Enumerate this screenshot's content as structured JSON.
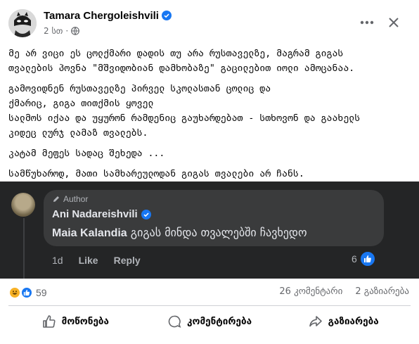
{
  "post": {
    "author": "Tamara Chergoleishvili",
    "time": "2 სთ",
    "menu_icon": "more-dots-icon",
    "close_icon": "close-icon",
    "paragraphs": [
      [
        "მე არ ვიცი ეს ცოლქმარი დადის თუ არა რუსთაველზე, მაგრამ გიგას",
        "თვალების პოვნა \"მშვიდობიან დამხობაზე\" გაცილებით იოლი ამოცანაა."
      ],
      [
        "გამოვიდნენ რუსთაველზე პირველ სკოლასთან ცოლიც და",
        "ქმარიც, გიგა თითქმის ყოველ",
        "სალმოს იქაა და უყურონ რამდენიც გაუხარდებათ - სთხოვონ და გაახელს",
        "კიდეც ლურჯ ლამაზ თვალებს."
      ],
      [
        "კატამ მეფეს სადაც შეხედა ..."
      ],
      [
        "სამწუხაროდ, მათი სამხარეულოდან გიგას თვალები არ ჩანს."
      ]
    ]
  },
  "comment": {
    "badge": "Author",
    "name": "Ani Nadareishvili",
    "mention": "Maia Kalandia",
    "text": " გიგას მინდა თვალებში ჩავხედო",
    "time": "1d",
    "like_label": "Like",
    "reply_label": "Reply",
    "like_count": "6"
  },
  "footer": {
    "reaction_count": "59",
    "comments": "26 კომენტარი",
    "shares": "2 გაზიარება",
    "actions": {
      "like": "მოწონება",
      "comment": "კომენტირება",
      "share": "გაზიარება"
    }
  },
  "colors": {
    "accent": "#1877f2",
    "comment_bg": "#242526",
    "bubble_bg": "#3a3b3c"
  }
}
